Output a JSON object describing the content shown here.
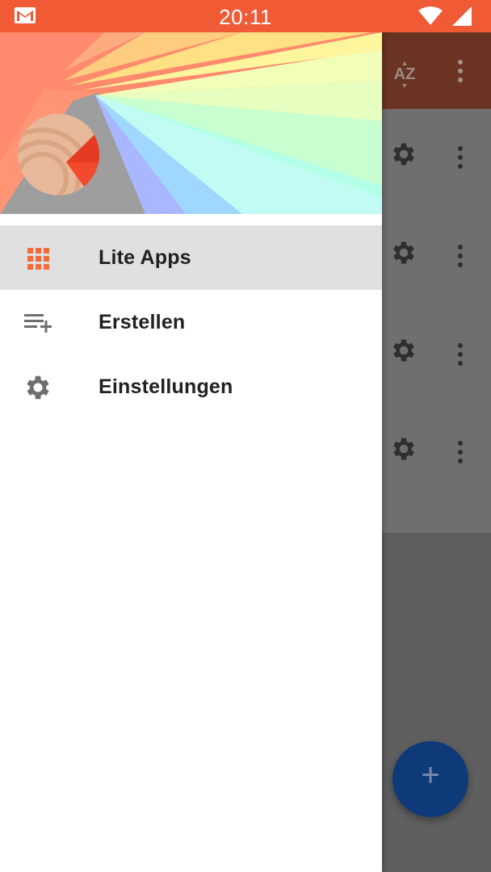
{
  "status_bar": {
    "time": "20:11",
    "icons": [
      "gmail-icon",
      "wifi-icon",
      "signal-icon"
    ],
    "color": "#f05a35"
  },
  "drawer": {
    "menu": [
      {
        "label": "Lite Apps",
        "icon": "apps-grid-icon",
        "active": true
      },
      {
        "label": "Erstellen",
        "icon": "playlist-add-icon",
        "active": false
      },
      {
        "label": "Einstellungen",
        "icon": "gear-icon",
        "active": false
      }
    ],
    "accent": "#f26b3a"
  },
  "background_app": {
    "toolbar": {
      "sort_icon_text": "AZ",
      "icons": [
        "sort-az-icon",
        "overflow-menu-icon"
      ]
    },
    "rows": 4,
    "fab": {
      "label": "+",
      "color": "#0f3a7a"
    }
  }
}
